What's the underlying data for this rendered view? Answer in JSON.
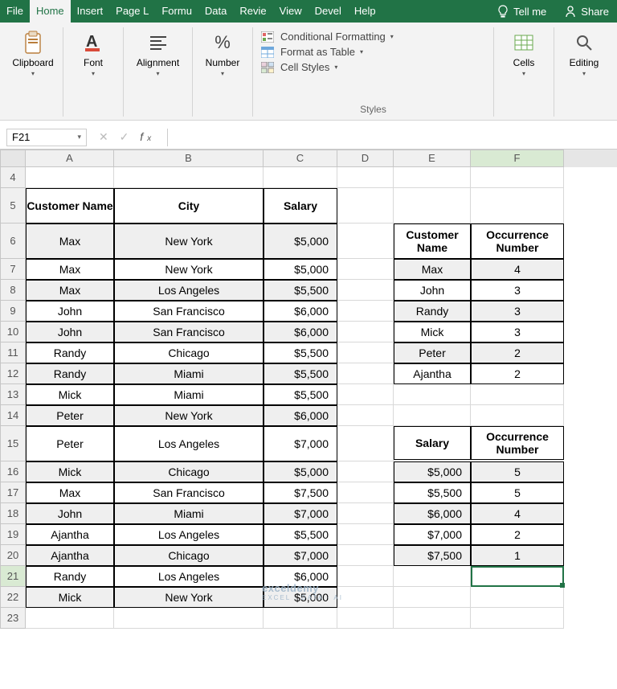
{
  "tabs": {
    "items": [
      "File",
      "Home",
      "Insert",
      "Page L",
      "Formu",
      "Data",
      "Revie",
      "View",
      "Devel",
      "Help"
    ],
    "tell": "Tell me",
    "share": "Share"
  },
  "ribbon": {
    "clipboard": {
      "label": "Clipboard"
    },
    "font": {
      "label": "Font"
    },
    "alignment": {
      "label": "Alignment"
    },
    "number": {
      "label": "Number",
      "percent": "%"
    },
    "styles": {
      "label": "Styles",
      "conditional": "Conditional Formatting",
      "table": "Format as Table",
      "cellstyles": "Cell Styles"
    },
    "cells": {
      "label": "Cells"
    },
    "editing": {
      "label": "Editing"
    }
  },
  "namebox": "F21",
  "columns": [
    "A",
    "B",
    "C",
    "D",
    "E",
    "F"
  ],
  "row_numbers": [
    4,
    5,
    6,
    7,
    8,
    9,
    10,
    11,
    12,
    13,
    14,
    15,
    16,
    17,
    18,
    19,
    20,
    21,
    22,
    23
  ],
  "main_headers": [
    "Customer Name",
    "City",
    "Salary"
  ],
  "main_rows": [
    [
      "Max",
      "New York",
      "$5,000"
    ],
    [
      "Max",
      "New York",
      "$5,000"
    ],
    [
      "Max",
      "Los Angeles",
      "$5,500"
    ],
    [
      "John",
      "San Francisco",
      "$6,000"
    ],
    [
      "John",
      "San Francisco",
      "$6,000"
    ],
    [
      "Randy",
      "Chicago",
      "$5,500"
    ],
    [
      "Randy",
      "Miami",
      "$5,500"
    ],
    [
      "Mick",
      "Miami",
      "$5,500"
    ],
    [
      "Peter",
      "New York",
      "$6,000"
    ],
    [
      "Peter",
      "Los Angeles",
      "$7,000"
    ],
    [
      "Mick",
      "Chicago",
      "$5,000"
    ],
    [
      "Max",
      "San Francisco",
      "$7,500"
    ],
    [
      "John",
      "Miami",
      "$7,000"
    ],
    [
      "Ajantha",
      "Los Angeles",
      "$5,500"
    ],
    [
      "Ajantha",
      "Chicago",
      "$7,000"
    ],
    [
      "Randy",
      "Los Angeles",
      "$6,000"
    ],
    [
      "Mick",
      "New York",
      "$5,000"
    ]
  ],
  "tableB": {
    "headers": [
      "Customer Name",
      "Occurrence Number"
    ],
    "rows": [
      [
        "Max",
        "4"
      ],
      [
        "John",
        "3"
      ],
      [
        "Randy",
        "3"
      ],
      [
        "Mick",
        "3"
      ],
      [
        "Peter",
        "2"
      ],
      [
        "Ajantha",
        "2"
      ]
    ]
  },
  "tableC": {
    "headers": [
      "Salary",
      "Occurrence Number"
    ],
    "rows": [
      [
        "$5,000",
        "5"
      ],
      [
        "$5,500",
        "5"
      ],
      [
        "$6,000",
        "4"
      ],
      [
        "$7,000",
        "2"
      ],
      [
        "$7,500",
        "1"
      ]
    ]
  },
  "watermark": {
    "line1": "exceldemy",
    "line2": "EXCEL · DATA · AI"
  },
  "icons": {
    "caret": "▾",
    "arrow": "→"
  }
}
